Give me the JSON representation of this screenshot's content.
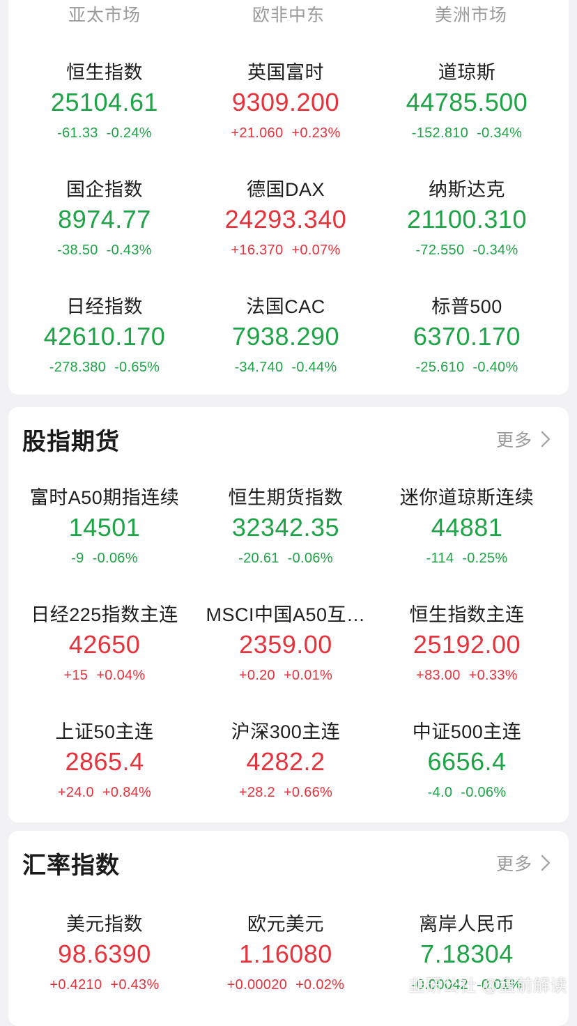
{
  "market_tabs": [
    "亚太市场",
    "欧非中东",
    "美洲市场"
  ],
  "global_indices": [
    {
      "name": "恒生指数",
      "price": "25104.61",
      "change": "-61.33",
      "pct": "-0.24%",
      "trend": "down"
    },
    {
      "name": "英国富时",
      "price": "9309.200",
      "change": "+21.060",
      "pct": "+0.23%",
      "trend": "up"
    },
    {
      "name": "道琼斯",
      "price": "44785.500",
      "change": "-152.810",
      "pct": "-0.34%",
      "trend": "down"
    },
    {
      "name": "国企指数",
      "price": "8974.77",
      "change": "-38.50",
      "pct": "-0.43%",
      "trend": "down"
    },
    {
      "name": "德国DAX",
      "price": "24293.340",
      "change": "+16.370",
      "pct": "+0.07%",
      "trend": "up"
    },
    {
      "name": "纳斯达克",
      "price": "21100.310",
      "change": "-72.550",
      "pct": "-0.34%",
      "trend": "down"
    },
    {
      "name": "日经指数",
      "price": "42610.170",
      "change": "-278.380",
      "pct": "-0.65%",
      "trend": "down"
    },
    {
      "name": "法国CAC",
      "price": "7938.290",
      "change": "-34.740",
      "pct": "-0.44%",
      "trend": "down"
    },
    {
      "name": "标普500",
      "price": "6370.170",
      "change": "-25.610",
      "pct": "-0.40%",
      "trend": "down"
    }
  ],
  "futures": {
    "title": "股指期货",
    "more_label": "更多",
    "items": [
      {
        "name": "富时A50期指连续",
        "price": "14501",
        "change": "-9",
        "pct": "-0.06%",
        "trend": "down"
      },
      {
        "name": "恒生期货指数",
        "price": "32342.35",
        "change": "-20.61",
        "pct": "-0.06%",
        "trend": "down"
      },
      {
        "name": "迷你道琼斯连续",
        "price": "44881",
        "change": "-114",
        "pct": "-0.25%",
        "trend": "down"
      },
      {
        "name": "日经225指数主连",
        "price": "42650",
        "change": "+15",
        "pct": "+0.04%",
        "trend": "up"
      },
      {
        "name": "MSCI中国A50互…",
        "price": "2359.00",
        "change": "+0.20",
        "pct": "+0.01%",
        "trend": "up"
      },
      {
        "name": "恒生指数主连",
        "price": "25192.00",
        "change": "+83.00",
        "pct": "+0.33%",
        "trend": "up"
      },
      {
        "name": "上证50主连",
        "price": "2865.4",
        "change": "+24.0",
        "pct": "+0.84%",
        "trend": "up"
      },
      {
        "name": "沪深300主连",
        "price": "4282.2",
        "change": "+28.2",
        "pct": "+0.66%",
        "trend": "up"
      },
      {
        "name": "中证500主连",
        "price": "6656.4",
        "change": "-4.0",
        "pct": "-0.06%",
        "trend": "down"
      }
    ]
  },
  "fx": {
    "title": "汇率指数",
    "more_label": "更多",
    "items": [
      {
        "name": "美元指数",
        "price": "98.6390",
        "change": "+0.4210",
        "pct": "+0.43%",
        "trend": "up"
      },
      {
        "name": "欧元美元",
        "price": "1.16080",
        "change": "+0.00020",
        "pct": "+0.02%",
        "trend": "up"
      },
      {
        "name": "离岸人民币",
        "price": "7.18304",
        "change": "-0.00042",
        "pct": "-0.01%",
        "trend": "down"
      }
    ]
  },
  "watermark": "韭研公社 @盘前解读",
  "colors": {
    "up": "#e5323b",
    "down": "#1ea346"
  }
}
